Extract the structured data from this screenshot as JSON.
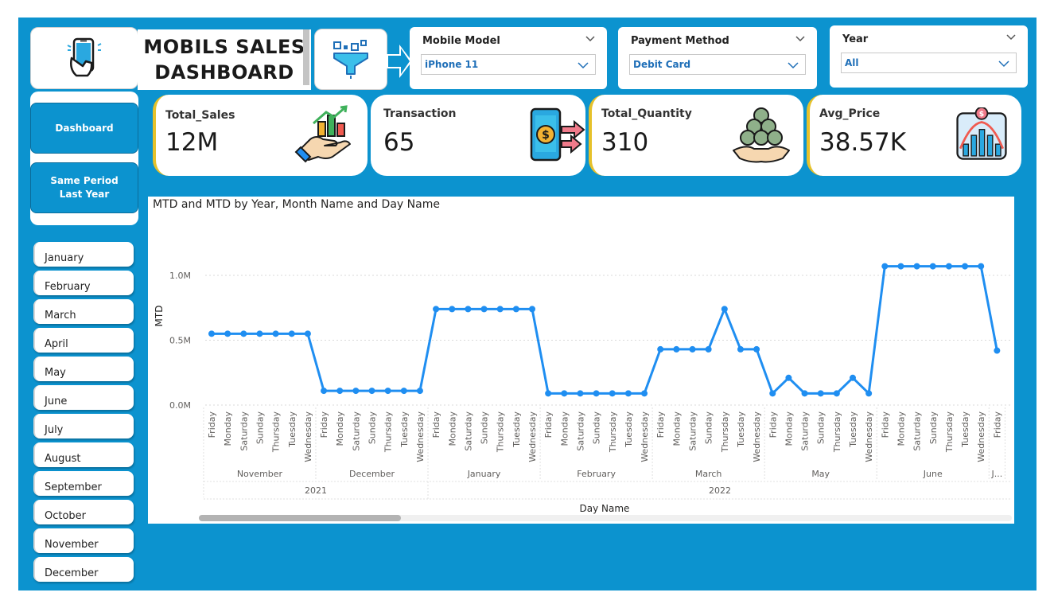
{
  "header": {
    "title_line1": "MOBILS SALES",
    "title_line2": "DASHBOARD",
    "logo_icon": "phone-hand-icon",
    "filter_icon": "funnel-icon"
  },
  "slicers": [
    {
      "label": "Mobile Model",
      "value": "iPhone 11"
    },
    {
      "label": "Payment Method",
      "value": "Debit Card"
    },
    {
      "label": "Year",
      "value": "All"
    }
  ],
  "kpis": [
    {
      "label": "Total_Sales",
      "value": "12M",
      "icon": "sales-growth-icon"
    },
    {
      "label": "Transaction",
      "value": "65",
      "icon": "mobile-payment-icon"
    },
    {
      "label": "Total_Quantity",
      "value": "310",
      "icon": "coins-hand-icon"
    },
    {
      "label": "Avg_Price",
      "value": "38.57K",
      "icon": "price-chart-icon"
    }
  ],
  "nav": {
    "dashboard": "Dashboard",
    "same_period": "Same Period Last Year"
  },
  "months": [
    "January",
    "February",
    "March",
    "April",
    "May",
    "June",
    "July",
    "August",
    "September",
    "October",
    "November",
    "December"
  ],
  "colors": {
    "background": "#0c93cf",
    "line": "#1f8ef1",
    "kpi_accent": "#e6c12a",
    "slicer_value": "#1f6fb8"
  },
  "chart_data": {
    "type": "line",
    "title": "MTD and MTD by Year, Month Name and Day Name",
    "xlabel": "Day Name",
    "ylabel": "MTD",
    "yticks": [
      "0.0M",
      "0.5M",
      "1.0M"
    ],
    "ylim": [
      0,
      1100000
    ],
    "grid": true,
    "groups": [
      {
        "year": "2021",
        "month": "November",
        "days": [
          "Friday",
          "Monday",
          "Saturday",
          "Sunday",
          "Thursday",
          "Tuesday",
          "Wednesday"
        ],
        "values": [
          550000,
          550000,
          550000,
          550000,
          550000,
          550000,
          550000
        ]
      },
      {
        "year": "2021",
        "month": "December",
        "days": [
          "Friday",
          "Monday",
          "Saturday",
          "Sunday",
          "Thursday",
          "Tuesday",
          "Wednesday"
        ],
        "values": [
          110000,
          110000,
          110000,
          110000,
          110000,
          110000,
          110000
        ]
      },
      {
        "year": "2022",
        "month": "January",
        "days": [
          "Friday",
          "Monday",
          "Saturday",
          "Sunday",
          "Thursday",
          "Tuesday",
          "Wednesday"
        ],
        "values": [
          740000,
          740000,
          740000,
          740000,
          740000,
          740000,
          740000
        ]
      },
      {
        "year": "2022",
        "month": "February",
        "days": [
          "Friday",
          "Monday",
          "Saturday",
          "Sunday",
          "Thursday",
          "Tuesday",
          "Wednesday"
        ],
        "values": [
          90000,
          90000,
          90000,
          90000,
          90000,
          90000,
          90000
        ]
      },
      {
        "year": "2022",
        "month": "March",
        "days": [
          "Friday",
          "Monday",
          "Saturday",
          "Sunday",
          "Thursday",
          "Tuesday",
          "Wednesday"
        ],
        "values": [
          430000,
          430000,
          430000,
          430000,
          740000,
          430000,
          430000
        ]
      },
      {
        "year": "2022",
        "month": "May",
        "days": [
          "Friday",
          "Monday",
          "Saturday",
          "Sunday",
          "Thursday",
          "Tuesday",
          "Wednesday"
        ],
        "values": [
          90000,
          210000,
          90000,
          90000,
          90000,
          210000,
          90000
        ]
      },
      {
        "year": "2022",
        "month": "June",
        "days": [
          "Friday",
          "Monday",
          "Saturday",
          "Sunday",
          "Thursday",
          "Tuesday",
          "Wednesday"
        ],
        "values": [
          1070000,
          1070000,
          1070000,
          1070000,
          1070000,
          1070000,
          1070000
        ]
      },
      {
        "year": "2022",
        "month": "J...",
        "days": [
          "Friday"
        ],
        "values": [
          420000
        ]
      }
    ]
  }
}
